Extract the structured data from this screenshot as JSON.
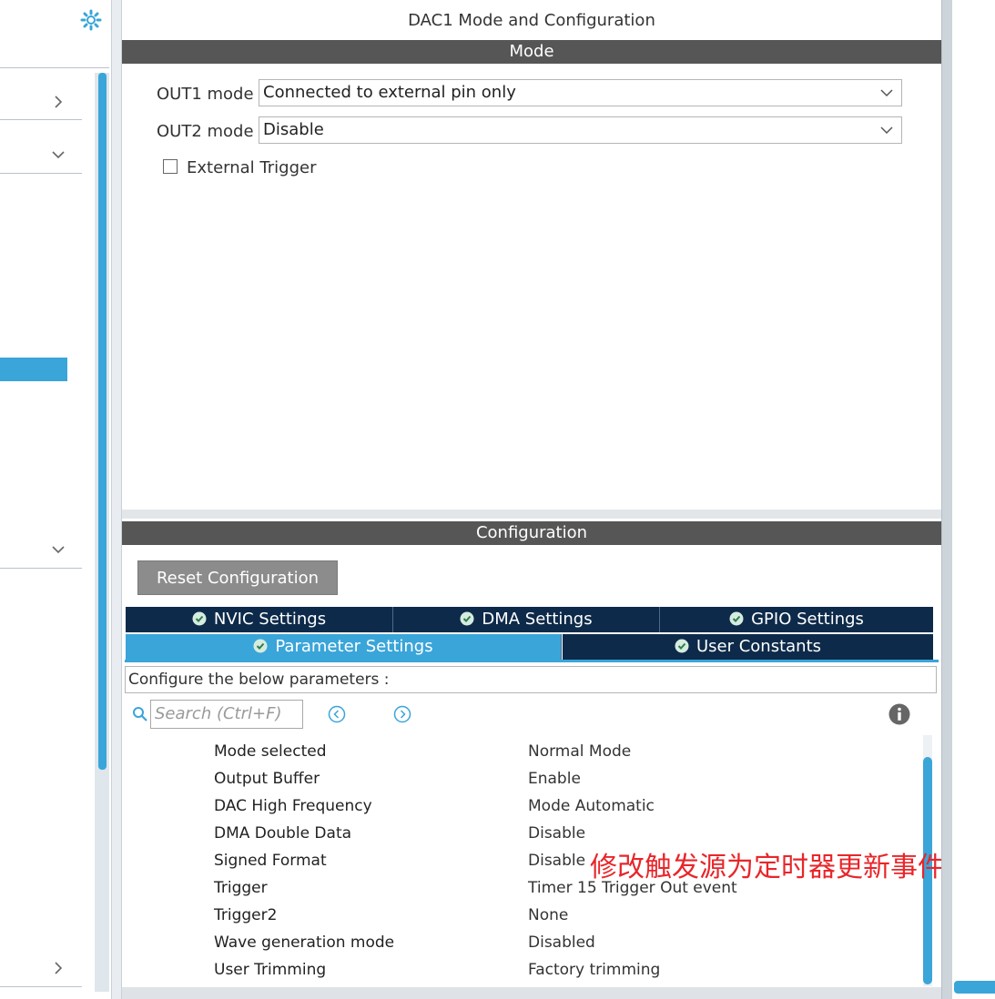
{
  "panel_title": "DAC1 Mode and Configuration",
  "mode": {
    "section_title": "Mode",
    "out1": {
      "label": "OUT1 mode",
      "value": "Connected to external pin only"
    },
    "out2": {
      "label": "OUT2 mode",
      "value": "Disable"
    },
    "external_trigger": {
      "label": "External Trigger",
      "checked": false
    }
  },
  "configuration": {
    "section_title": "Configuration",
    "reset_label": "Reset Configuration",
    "tabs_row1": [
      "NVIC Settings",
      "DMA Settings",
      "GPIO Settings"
    ],
    "tabs_row2": [
      "Parameter Settings",
      "User Constants"
    ],
    "active_tab": "Parameter Settings",
    "description": "Configure the below parameters :",
    "search_placeholder": "Search (Ctrl+F)",
    "parameters": [
      {
        "name": "Mode selected",
        "value": "Normal Mode"
      },
      {
        "name": "Output Buffer",
        "value": "Enable"
      },
      {
        "name": "DAC High Frequency",
        "value": "Mode Automatic"
      },
      {
        "name": "DMA Double Data",
        "value": "Disable"
      },
      {
        "name": "Signed Format",
        "value": "Disable"
      },
      {
        "name": "Trigger",
        "value": "Timer 15 Trigger Out event"
      },
      {
        "name": "Trigger2",
        "value": "None"
      },
      {
        "name": "Wave generation mode",
        "value": "Disabled"
      },
      {
        "name": "User Trimming",
        "value": "Factory trimming"
      }
    ]
  },
  "annotation": "修改触发源为定时器更新事件",
  "colors": {
    "accent": "#3aa5d9",
    "tab_dark": "#0d2a4a",
    "section_bar": "#565656",
    "annotation": "#e8262a"
  },
  "icons": [
    "gear-icon",
    "chevron-right-icon",
    "chevron-down-icon",
    "check-circle-icon",
    "search-icon",
    "prev-circle-icon",
    "next-circle-icon",
    "info-icon"
  ]
}
